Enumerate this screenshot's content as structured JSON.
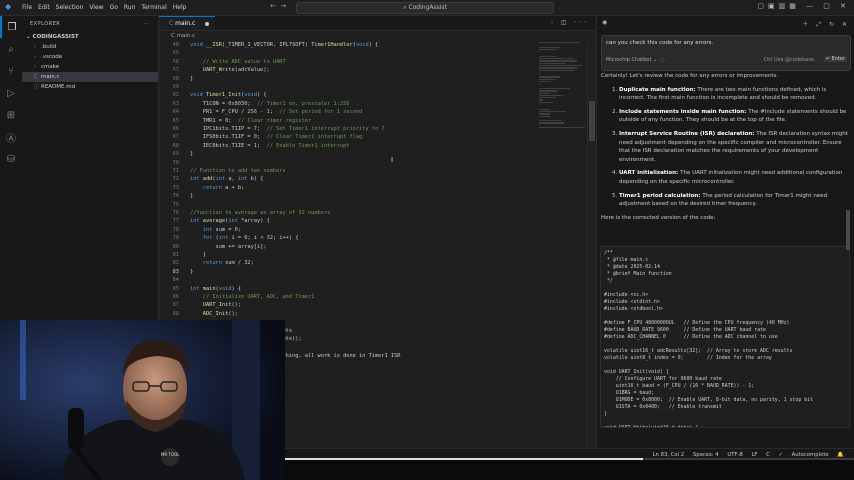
{
  "menu": [
    "File",
    "Edit",
    "Selection",
    "View",
    "Go",
    "Run",
    "Terminal",
    "Help"
  ],
  "command_center": "CodingAssist",
  "explorer": {
    "header": "EXPLORER",
    "root": "CODINGASSIST",
    "items": [
      {
        "label": ".build",
        "kind": "folder"
      },
      {
        "label": ".vscode",
        "kind": "folder"
      },
      {
        "label": "cmake",
        "kind": "folder"
      },
      {
        "label": "main.c",
        "kind": "c"
      },
      {
        "label": "README.md",
        "kind": "md"
      }
    ]
  },
  "editor": {
    "tab": "main.c",
    "breadcrumb": "C  main.c",
    "current_line": 83,
    "lines": [
      {
        "n": "48",
        "t": "void __ISR(_TIMER_1_VECTOR, IPL7SOFT) Timer1Handler(void) {"
      },
      {
        "n": "55",
        "t": ""
      },
      {
        "n": "56",
        "t": "    // Write ADC value to UART"
      },
      {
        "n": "57",
        "t": "    UART_Write(adcValue);"
      },
      {
        "n": "58",
        "t": "}"
      },
      {
        "n": "59",
        "t": ""
      },
      {
        "n": "62",
        "t": "void Timer1_Init(void) {"
      },
      {
        "n": "63",
        "t": "    T1CON = 0x8030;  // Timer1 on, prescaler 1:256"
      },
      {
        "n": "64",
        "t": "    PR1 = F_CPU / 256 - 1;  // Set period for 1 second"
      },
      {
        "n": "65",
        "t": "    TMR1 = 0;  // Clear timer register"
      },
      {
        "n": "66",
        "t": "    IPC1bits.T1IP = 7;  // Set Timer1 interrupt priority to 7"
      },
      {
        "n": "67",
        "t": "    IFS0bits.T1IF = 0;  // Clear Timer1 interrupt flag"
      },
      {
        "n": "68",
        "t": "    IEC0bits.T1IE = 1;  // Enable Timer1 interrupt"
      },
      {
        "n": "69",
        "t": "}"
      },
      {
        "n": "70",
        "t": ""
      },
      {
        "n": "71",
        "t": "// Function to add two numbers"
      },
      {
        "n": "72",
        "t": "int add(int a, int b) {"
      },
      {
        "n": "73",
        "t": "    return a + b;"
      },
      {
        "n": "74",
        "t": "}"
      },
      {
        "n": "75",
        "t": ""
      },
      {
        "n": "76",
        "t": "//function to average an array of 32 numbers"
      },
      {
        "n": "77",
        "t": "int average(int *array) {"
      },
      {
        "n": "78",
        "t": "    int sum = 0;"
      },
      {
        "n": "79",
        "t": "    for (int i = 0; i < 32; i++) {"
      },
      {
        "n": "80",
        "t": "        sum += array[i];"
      },
      {
        "n": "81",
        "t": "    }"
      },
      {
        "n": "82",
        "t": "    return sum / 32;"
      },
      {
        "n": "83",
        "t": "}"
      },
      {
        "n": "84",
        "t": ""
      },
      {
        "n": "85",
        "t": "int main(void) {"
      },
      {
        "n": "86",
        "t": "    // Initialize UART, ADC, and Timer1"
      },
      {
        "n": "87",
        "t": "    UART_Init();"
      },
      {
        "n": "88",
        "t": "    ADC_Init();"
      },
      {
        "n": "",
        "t": ""
      },
      {
        "n": "",
        "t": "                             pts"
      },
      {
        "n": "",
        "t": "                             pts();"
      },
      {
        "n": "",
        "t": ""
      },
      {
        "n": "",
        "t": "                             thing, all work is done in Timer1 ISR"
      }
    ]
  },
  "chat": {
    "question": "can you check this code for any errors.",
    "model": "Microchip Chatbot",
    "hint": "Ctrl Use @codebase",
    "enter": "Enter",
    "intro": "Certainly! Let's review the code for any errors or improvements.",
    "points": [
      {
        "title": "Duplicate main function:",
        "body": "There are two main functions defined, which is incorrect. The first main function is incomplete and should be removed."
      },
      {
        "title": "Include statements inside main function:",
        "body": "The #include statements should be outside of any function. They should be at the top of the file."
      },
      {
        "title": "Interrupt Service Routine (ISR) declaration:",
        "body": "The ISR declaration syntax might need adjustment depending on the specific compiler and microcontroller. Ensure that the ISR declaration matches the requirements of your development environment."
      },
      {
        "title": "UART initialization:",
        "body": "The UART initialization might need additional configuration depending on the specific microcontroller."
      },
      {
        "title": "Timer1 period calculation:",
        "body": "The period calculation for Timer1 might need adjustment based on the desired timer frequency."
      }
    ],
    "outro": "Here is the corrected version of the code:",
    "code": "/**\n * @file main.c\n * @date 2025-02-14\n * @brief Main function\n */\n\n#include <xc.h>\n#include <stdint.h>\n#include <stdbool.h>\n\n#define F_CPU 48000000UL   // Define the CPU frequency (48 MHz)\n#define BAUD_RATE 9600     // Define the UART baud rate\n#define ADC_CHANNEL 0      // Define the ADC channel to use\n\nvolatile uint16_t adcResults[32];  // Array to store ADC results\nvolatile uint8_t index = 0;        // Index for the array\n\nvoid UART_Init(void) {\n    // Configure UART for 9600 baud rate\n    uint16_t baud = (F_CPU / (16 * BAUD_RATE)) - 1;\n    U1BRG = baud;\n    U1MODE = 0x8000;  // Enable UART, 8-bit data, no parity, 1 stop bit\n    U1STA = 0x0400;   // Enable transmit\n}\n\nvoid UART_Write(uint16_t data) {"
  },
  "status": {
    "position": "Ln 83, Col 2",
    "spaces": "Spaces: 4",
    "encoding": "UTF-8",
    "eol": "LF",
    "lang": "C",
    "autocomplete": "Autocomplete",
    "progress": 0.63
  },
  "webcam_logo": "MR TOOL"
}
